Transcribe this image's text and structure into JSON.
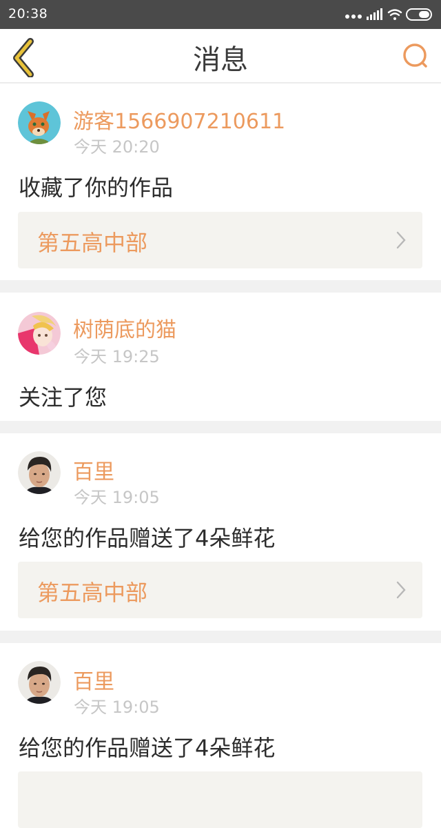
{
  "status_bar": {
    "time": "20:38"
  },
  "nav": {
    "title": "消息",
    "accent_color": "#ec9a5e"
  },
  "notifications": [
    {
      "username": "游客1566907210611",
      "time": "今天 20:20",
      "message": "收藏了你的作品",
      "work_title": "第五高中部",
      "avatar_icon": "fox-avatar"
    },
    {
      "username": "树荫底的猫",
      "time": "今天 19:25",
      "message": "关注了您",
      "avatar_icon": "anime-girl-avatar"
    },
    {
      "username": "百里",
      "time": "今天 19:05",
      "message": "给您的作品赠送了4朵鲜花",
      "work_title": "第五高中部",
      "avatar_icon": "boy-photo-avatar"
    },
    {
      "username": "百里",
      "time": "今天 19:05",
      "message": "给您的作品赠送了4朵鲜花",
      "avatar_icon": "boy-photo-avatar"
    }
  ]
}
